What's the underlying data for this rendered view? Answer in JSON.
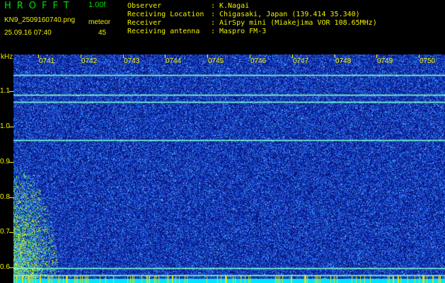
{
  "header": {
    "app_title": "HROFFT",
    "version": "1.00f",
    "file_name": "KN9_2509160740.png",
    "meteor_label": "meteor",
    "meteor_count": "45",
    "datetime": "25.09.16 07:40"
  },
  "info": [
    {
      "key": "Observer",
      "value": "K.Nagai"
    },
    {
      "key": "Receiving Location",
      "value": "Chigasaki, Japan (139.414 35.340)"
    },
    {
      "key": "Receiver",
      "value": "AirSpy mini (Miakejima VOR 108.65MHz)"
    },
    {
      "key": "Receiving antenna",
      "value": "Maspro FM-3"
    }
  ],
  "axis": {
    "unit": "kHz",
    "y_labels": [
      "1.1",
      "1.0",
      "0.9",
      "0.8",
      "0.7",
      "0.6"
    ],
    "x_labels": [
      "0741",
      "0742",
      "0743",
      "0744",
      "0745",
      "0746",
      "0747",
      "0748",
      "0749",
      "0750"
    ]
  },
  "colors": {
    "background": "#000000",
    "text_yellow": "#f0f000",
    "title_green": "#00e000",
    "spectrum_base": "#0a1a78",
    "noise_bright": "#3a78ff",
    "carrier_line": "#80ffcc",
    "baseline_band": "#00e5ff"
  },
  "spectrogram": {
    "y_min_khz": 0.58,
    "y_max_khz": 1.16,
    "carrier_lines_khz": [
      1.108,
      1.058,
      1.04,
      0.942,
      0.618,
      0.6
    ],
    "x_start_minute": 0,
    "x_end_minute": 10
  }
}
